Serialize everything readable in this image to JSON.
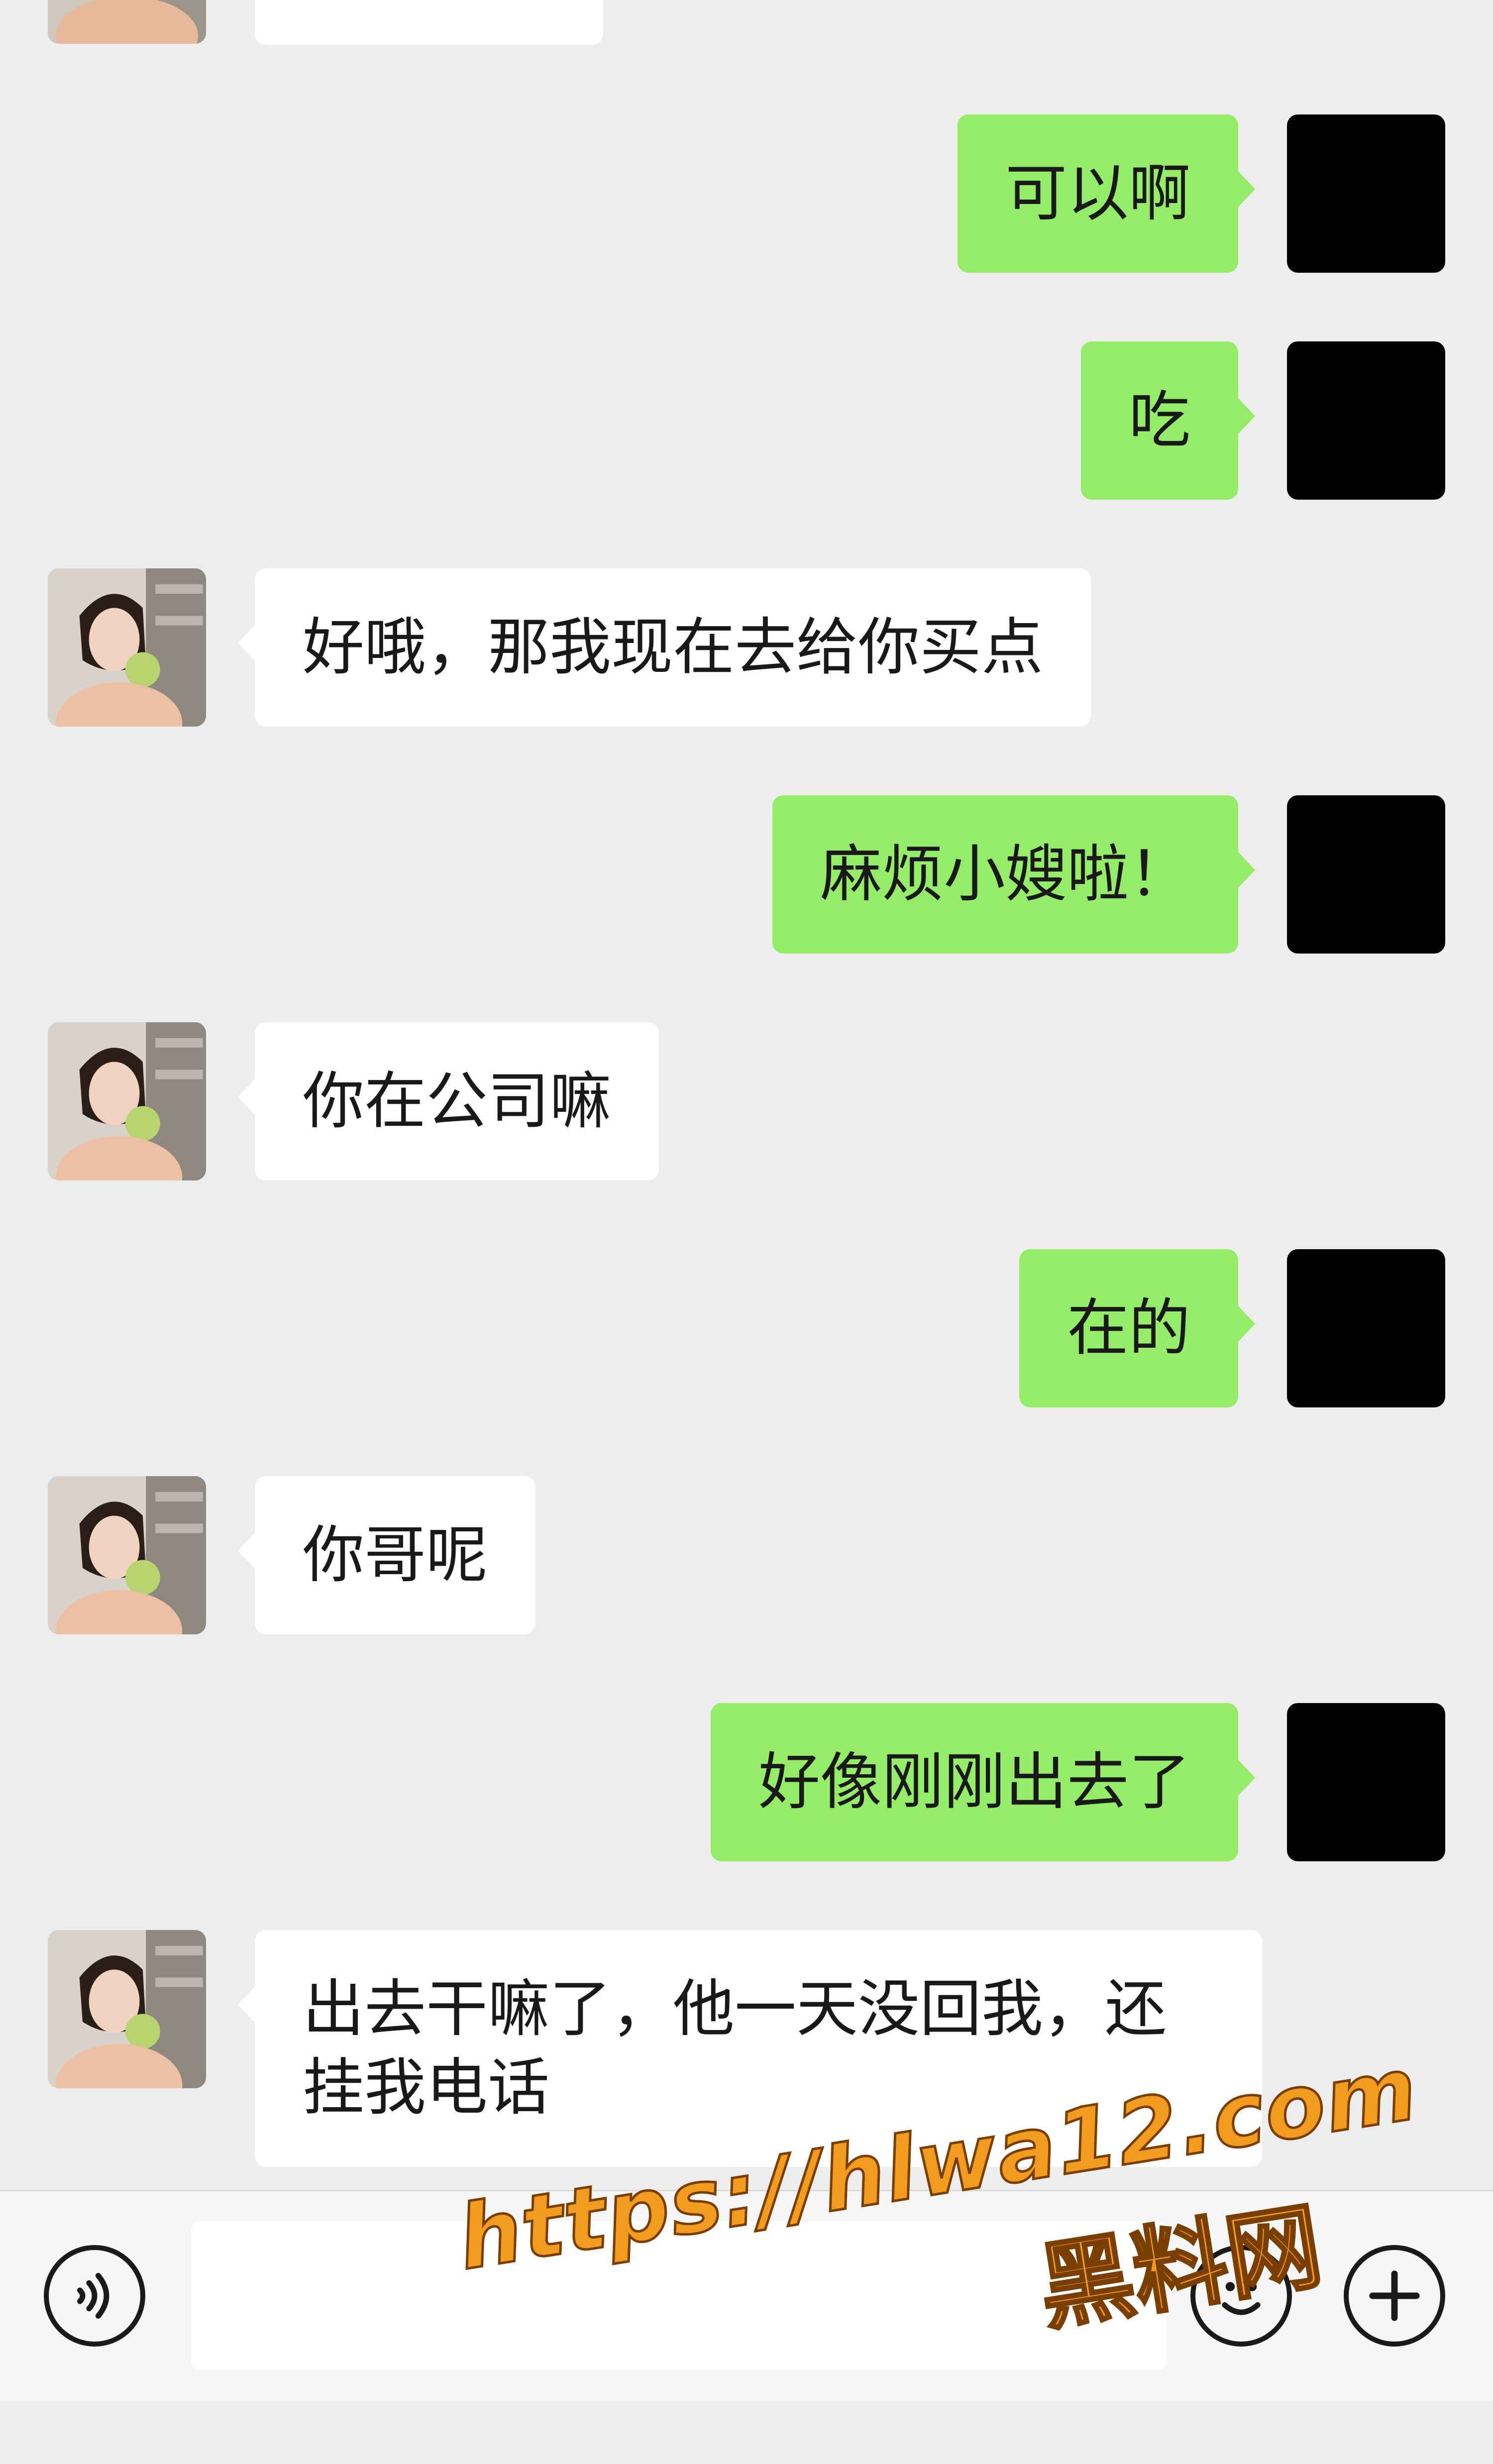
{
  "conversation": {
    "messages": [
      {
        "side": "right",
        "text": "可以啊"
      },
      {
        "side": "right",
        "text": "吃"
      },
      {
        "side": "left",
        "text": "好哦，那我现在去给你买点"
      },
      {
        "side": "right",
        "text": "麻烦小嫂啦！"
      },
      {
        "side": "left",
        "text": "你在公司嘛"
      },
      {
        "side": "right",
        "text": "在的"
      },
      {
        "side": "left",
        "text": "你哥呢"
      },
      {
        "side": "right",
        "text": "好像刚刚出去了"
      },
      {
        "side": "left",
        "text": "出去干嘛了，他一天没回我，还挂我电话"
      }
    ]
  },
  "input_bar": {
    "message_value": "",
    "voice_icon": "voice-icon",
    "emoji_icon": "emoji-icon",
    "plus_icon": "plus-icon"
  },
  "watermark": {
    "url": "https://hlwa12.com",
    "name": "黑料网"
  },
  "colors": {
    "background": "#ededed",
    "sent_bubble": "#95ec69",
    "received_bubble": "#ffffff",
    "own_avatar": "#000000",
    "watermark": "#f29c1f"
  }
}
